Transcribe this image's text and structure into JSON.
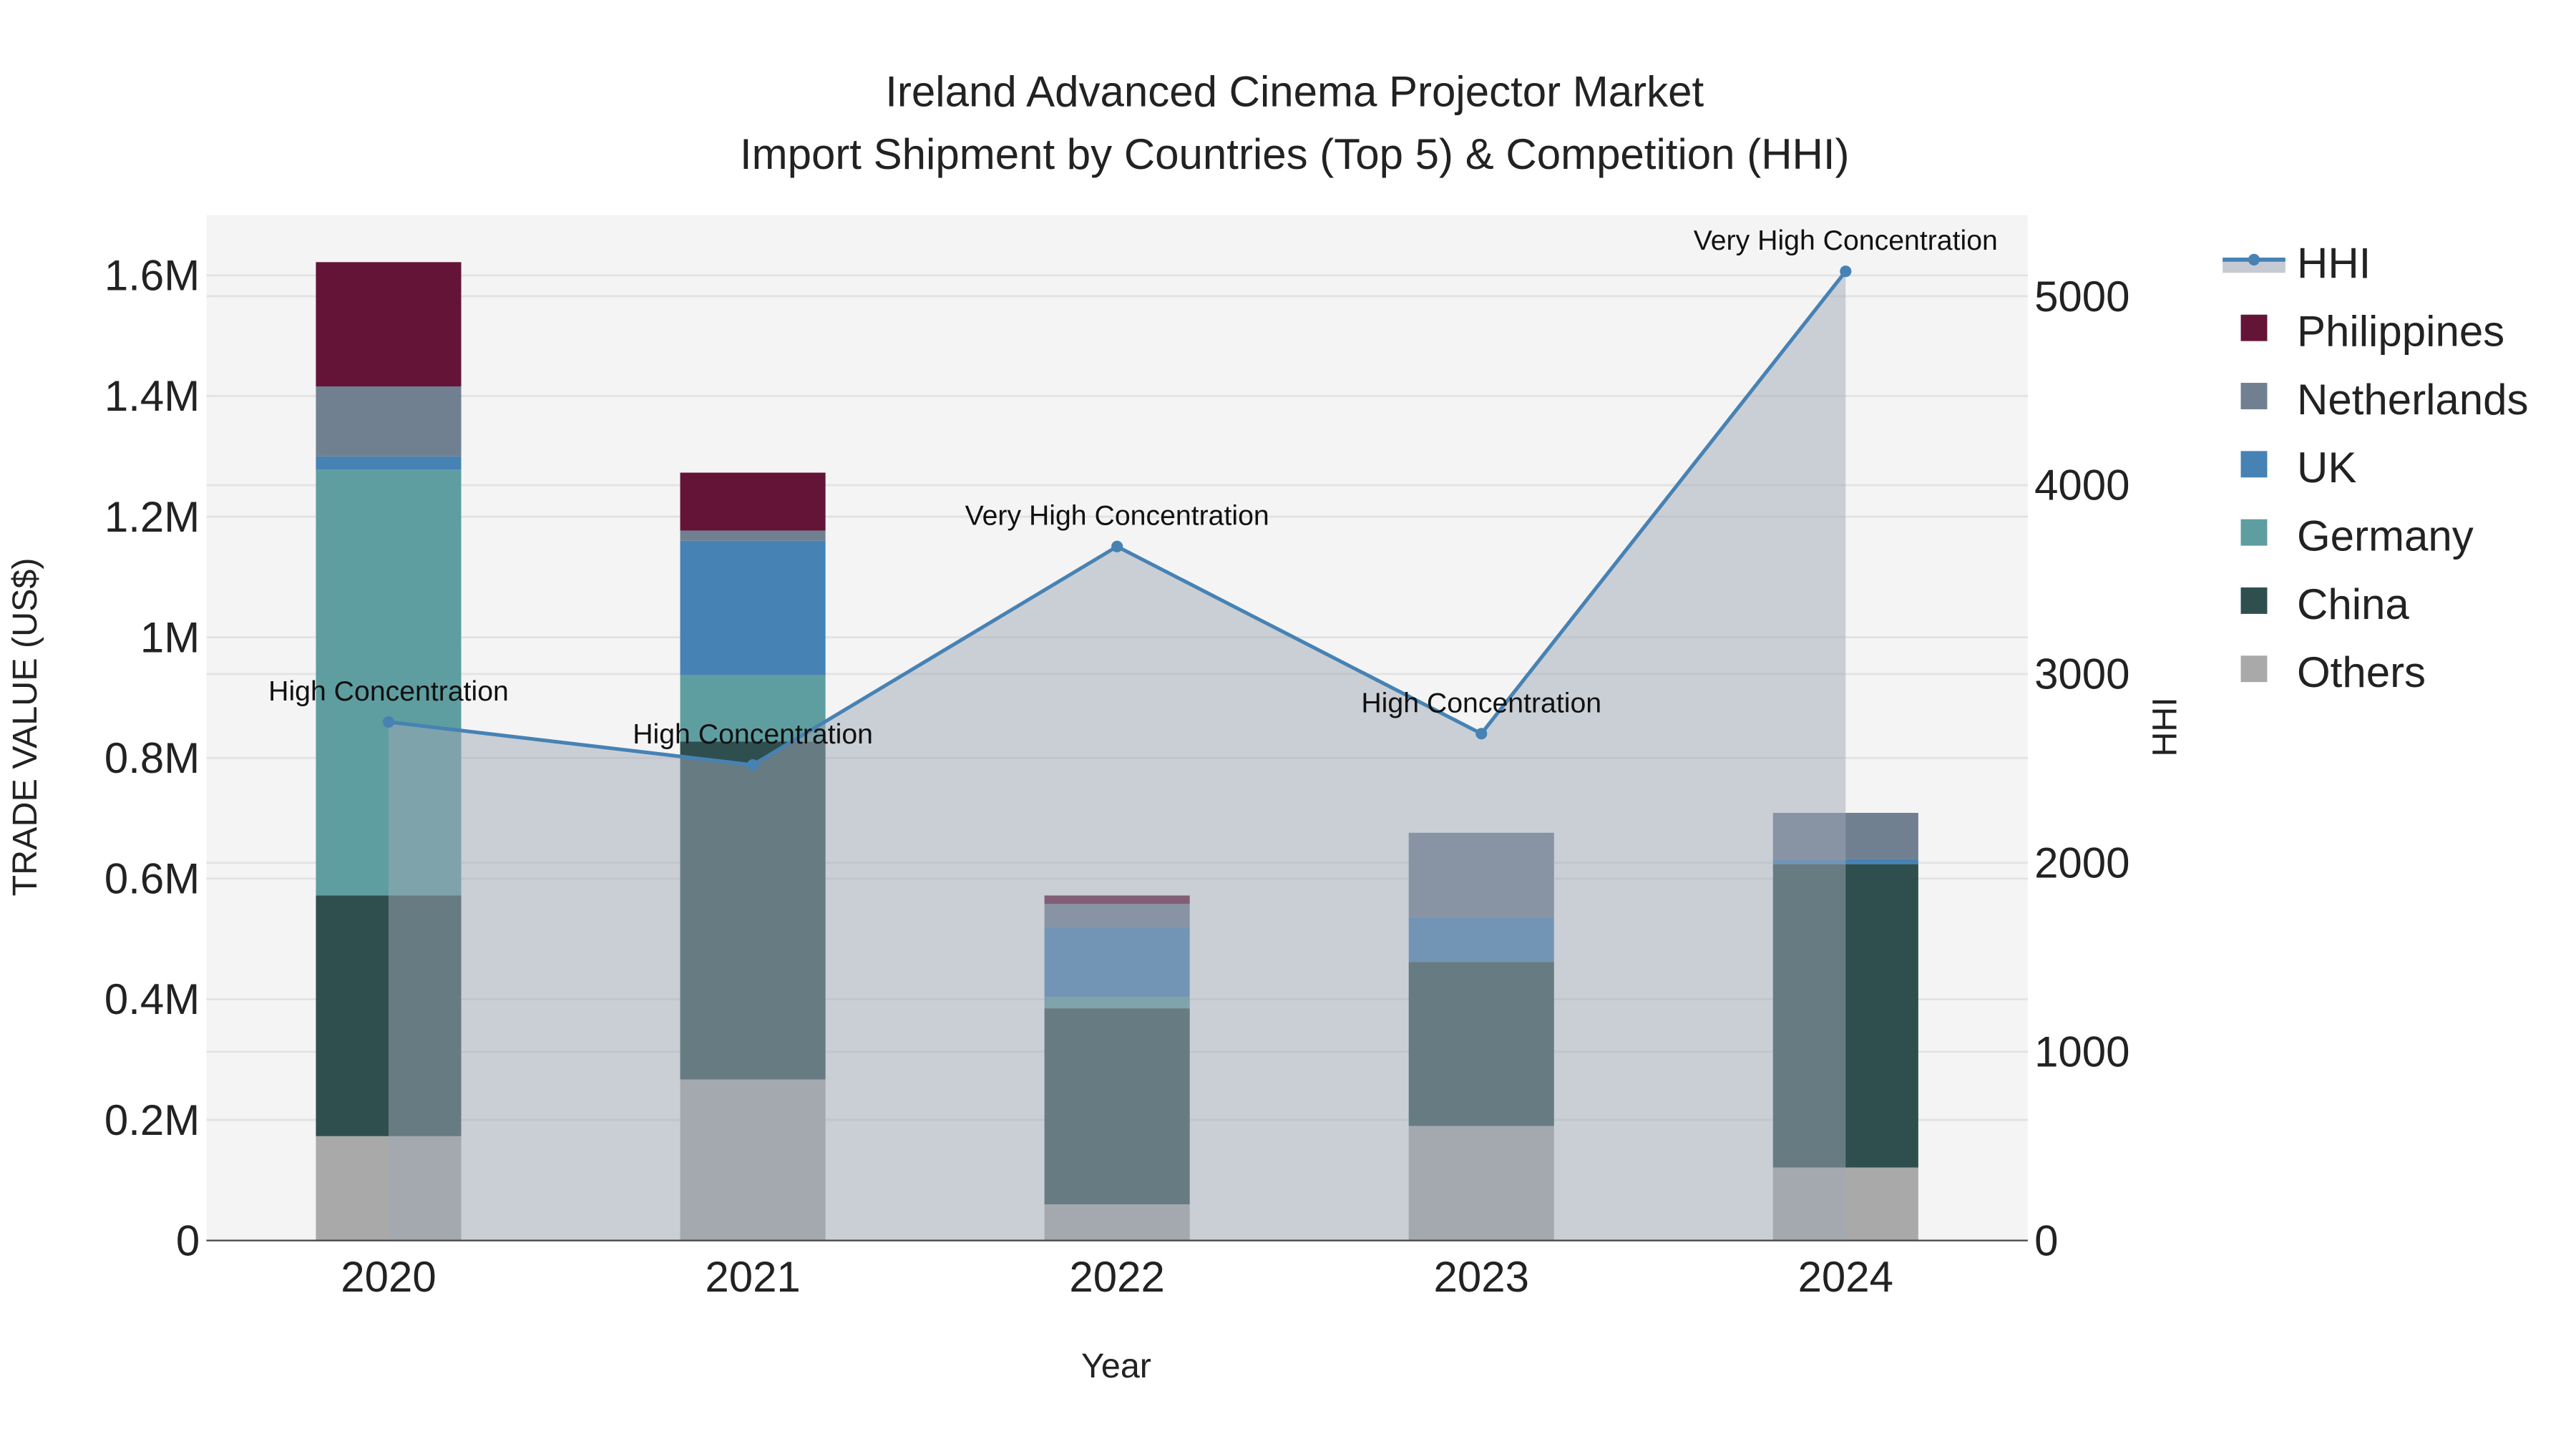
{
  "chart_data": {
    "type": "bar",
    "title": "Ireland Advanced Cinema Projector Market",
    "subtitle": "Import Shipment by Countries (Top 5) & Competition (HHI)",
    "xlabel": "Year",
    "ylabel": "TRADE VALUE (US$)",
    "y2label": "HHI",
    "categories": [
      "2020",
      "2021",
      "2022",
      "2023",
      "2024"
    ],
    "ylim": [
      0,
      1700000
    ],
    "y2lim": [
      0,
      5430
    ],
    "yticks": [
      0,
      200000,
      400000,
      600000,
      800000,
      1000000,
      1200000,
      1400000,
      1600000
    ],
    "ytick_labels": [
      "0",
      "0.2M",
      "0.4M",
      "0.6M",
      "0.8M",
      "1M",
      "1.2M",
      "1.4M",
      "1.6M"
    ],
    "y2ticks": [
      0,
      1000,
      2000,
      3000,
      4000,
      5000
    ],
    "y2tick_labels": [
      "0",
      "1000",
      "2000",
      "3000",
      "4000",
      "5000"
    ],
    "grid": true,
    "legend_placement": "right",
    "series": [
      {
        "name": "Others",
        "color": "#A9A9A9",
        "values": [
          173000,
          267000,
          60000,
          190000,
          121000
        ]
      },
      {
        "name": "China",
        "color": "#2F4F4F",
        "values": [
          399000,
          560000,
          325000,
          272000,
          503000
        ]
      },
      {
        "name": "Germany",
        "color": "#5F9EA0",
        "values": [
          706000,
          110000,
          19000,
          0,
          0
        ]
      },
      {
        "name": "UK",
        "color": "#4682B4",
        "values": [
          22000,
          223000,
          116000,
          74000,
          8000
        ]
      },
      {
        "name": "Netherlands",
        "color": "#708090",
        "values": [
          116000,
          17000,
          38000,
          140000,
          77000
        ]
      },
      {
        "name": "Philippines",
        "color": "#641437",
        "values": [
          206000,
          96000,
          14000,
          0,
          0
        ]
      }
    ],
    "hhi": {
      "name": "HHI",
      "color": "#4682B4",
      "values": [
        2746,
        2518,
        3675,
        2684,
        5132
      ],
      "annotations": [
        "High Concentration",
        "High Concentration",
        "Very High Concentration",
        "High Concentration",
        "Very High Concentration"
      ]
    },
    "legend": [
      "HHI",
      "Philippines",
      "Netherlands",
      "UK",
      "Germany",
      "China",
      "Others"
    ]
  }
}
